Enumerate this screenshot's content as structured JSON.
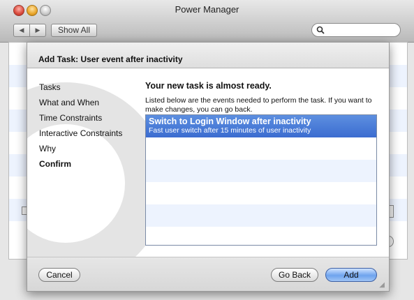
{
  "window": {
    "title": "Power Manager"
  },
  "toolbar": {
    "show_all_label": "Show All",
    "search_placeholder": ""
  },
  "sheet": {
    "title": "Add Task: User event after inactivity",
    "steps": [
      "Tasks",
      "What and When",
      "Time Constraints",
      "Interactive Constraints",
      "Why",
      "Confirm"
    ],
    "current_step": "Confirm",
    "heading": "Your new task is almost ready.",
    "description": "Listed below are the events needed to perform the task. If you want to make changes, you can go back.",
    "events": [
      {
        "title": "Switch to Login Window after inactivity",
        "subtitle": "Fast user switch after 15 minutes of user inactivity"
      }
    ],
    "buttons": {
      "cancel": "Cancel",
      "back": "Go Back",
      "add": "Add"
    }
  },
  "colors": {
    "selection": "#3b6cd0",
    "default_button": "#6ea3ee",
    "alt_row": "#edf3fe"
  },
  "icons": [
    "search-icon",
    "back-arrow-icon",
    "forward-arrow-icon",
    "resize-grip-icon"
  ]
}
